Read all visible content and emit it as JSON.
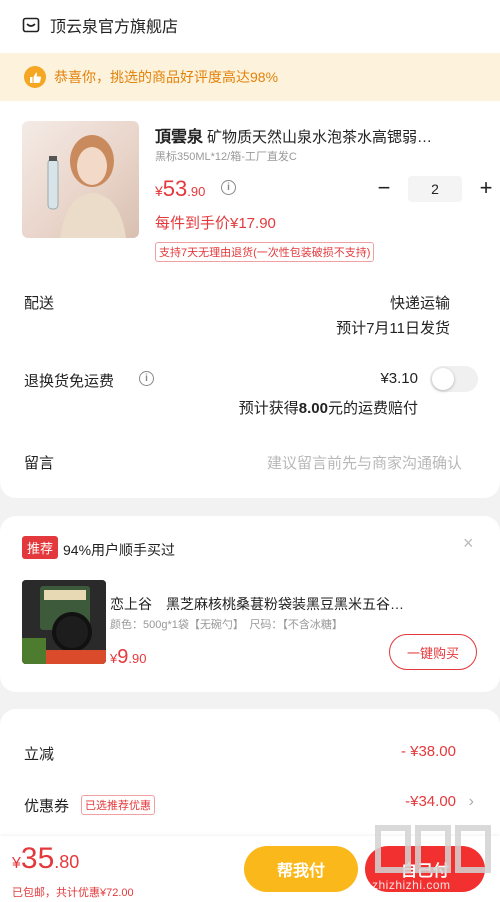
{
  "store": {
    "name": "顶云泉官方旗舰店",
    "icon": "store-icon"
  },
  "banner": {
    "text": "恭喜你，挑选的商品好评度高达98%",
    "icon": "thumbs-up-icon"
  },
  "product": {
    "brand": "頂雲泉",
    "title": "矿物质天然山泉水泡茶水高锶弱…",
    "spec": "黑标350ML*12/箱-工厂直发C",
    "price_currency": "¥",
    "price_int": "53",
    "price_dec": ".90",
    "quantity": "2",
    "minus": "−",
    "plus": "+",
    "unit_price": "每件到手价¥17.90",
    "return_policy": "支持7天无理由退货(一次性包装破损不支持)"
  },
  "delivery": {
    "label": "配送",
    "method": "快递运输",
    "eta": "预计7月11日发货"
  },
  "return_shipping": {
    "label": "退换货免运费",
    "price": "¥3.10",
    "note_prefix": "预计获得",
    "note_amount": "8.00",
    "note_suffix": "元的运费赔付",
    "enabled": false
  },
  "message": {
    "label": "留言",
    "placeholder": "建议留言前先与商家沟通确认"
  },
  "recommend": {
    "tag": "推荐",
    "title": "94%用户顺手买过",
    "close": "×",
    "item_title": "恋上谷　黑芝麻核桃桑葚粉袋装黑豆黑米五谷…",
    "item_spec": "颜色：500g*1袋【无碗勺】　尺码：【不含冰糖】",
    "item_price_currency": "¥",
    "item_price_int": "9",
    "item_price_dec": ".90",
    "buy_label": "一键购买"
  },
  "summary": {
    "discount_label": "立减",
    "discount_value": "- ¥38.00",
    "coupon_label": "优惠券",
    "coupon_tag": "已选推荐优惠",
    "coupon_value": "-¥34.00",
    "chevron": "›"
  },
  "bottom": {
    "total_currency": "¥",
    "total_int": "35",
    "total_dec": ".80",
    "note": "已包邮，共计优惠¥72.00",
    "help_pay": "帮我付",
    "self_pay": "自己付"
  },
  "watermark": {
    "url": "zhizhizhi.com"
  },
  "colors": {
    "accent": "#e4393c",
    "yellow": "#fbb81b",
    "banner_bg": "#fdf3dc"
  }
}
